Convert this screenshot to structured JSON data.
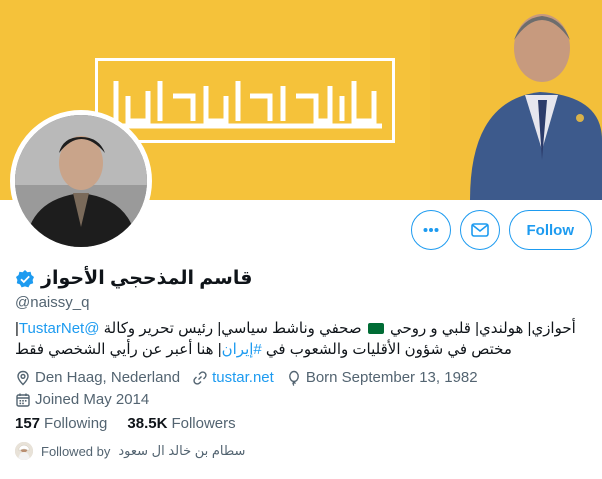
{
  "profile": {
    "name": "قاسم المذحجي الأحواز",
    "handle": "@naissy_q",
    "bio_line1_prefix": "أحوازي| هولندي| قلبي و روحي ",
    "bio_line1_suffix": " صحفي وناشط سياسي| رئيس تحرير وكالة ",
    "bio_mention": "@TustarNet",
    "bio_line1_end": "|",
    "bio_line2_prefix": "مختص في شؤون الأقليات والشعوب في ",
    "bio_hashtag": "#إيران",
    "bio_line2_suffix": "| هنا أعبر عن رأيي الشخصي فقط",
    "location": "Den Haag, Nederland",
    "website": "tustar.net",
    "birthday": "Born September 13, 1982",
    "joined": "Joined May 2014"
  },
  "stats": {
    "following_count": "157",
    "following_label": "Following",
    "followers_count": "38.5K",
    "followers_label": "Followers"
  },
  "followed_by": {
    "prefix": "Followed by",
    "name": "سطام بن خالد ال سعود"
  },
  "actions": {
    "more_icon": "more-dots-icon",
    "message_icon": "mail-icon",
    "follow_label": "Follow"
  },
  "colors": {
    "accent": "#1d9bf0",
    "banner": "#f5c23a",
    "secondary_text": "#536471"
  }
}
